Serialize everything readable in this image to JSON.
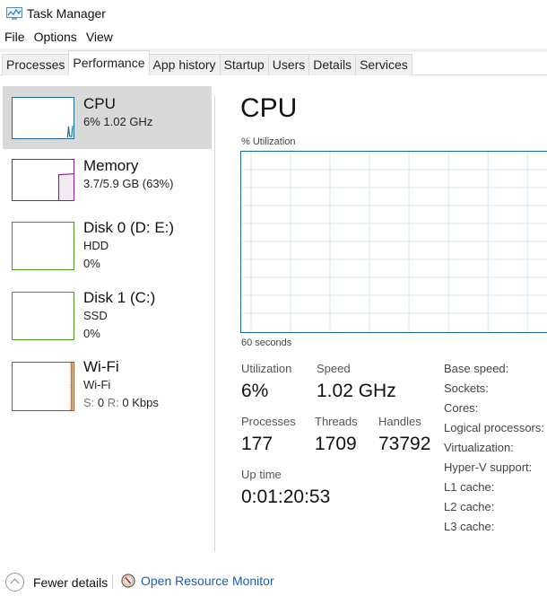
{
  "window": {
    "title": "Task Manager",
    "icon": "task-manager-icon"
  },
  "menu": [
    "File",
    "Options",
    "View"
  ],
  "tabs": [
    {
      "label": "Processes",
      "active": false
    },
    {
      "label": "Performance",
      "active": true
    },
    {
      "label": "App history",
      "active": false
    },
    {
      "label": "Startup",
      "active": false
    },
    {
      "label": "Users",
      "active": false
    },
    {
      "label": "Details",
      "active": false
    },
    {
      "label": "Services",
      "active": false
    }
  ],
  "sidebar": {
    "items": [
      {
        "title": "CPU",
        "line1": "6%  1.02 GHz",
        "line2": "",
        "color": "#1b6a96",
        "selected": true,
        "graph_values_pct": [
          0,
          0,
          0,
          0,
          0,
          0,
          0,
          0,
          0,
          0,
          0,
          0,
          0,
          0,
          0,
          0,
          0,
          0,
          0,
          0,
          0,
          0,
          0,
          0,
          0,
          0,
          0,
          0,
          0,
          0,
          0,
          0,
          0,
          0,
          0,
          0,
          0,
          0,
          0,
          0,
          0,
          0,
          0,
          0,
          0,
          0,
          0,
          0,
          0,
          0,
          0,
          0,
          0,
          0,
          0,
          28,
          4,
          2,
          2,
          30
        ]
      },
      {
        "title": "Memory",
        "line1": "3.7/5.9 GB (63%)",
        "line2": "",
        "color": "#8b1a9b",
        "selected": false,
        "graph_values_pct": [
          63
        ]
      },
      {
        "title": "Disk 0 (D: E:)",
        "line1": "HDD",
        "line2": "0%",
        "color": "#4b9a1f",
        "selected": false
      },
      {
        "title": "Disk 1 (C:)",
        "line1": "SSD",
        "line2": "0%",
        "color": "#4b9a1f",
        "selected": false
      },
      {
        "title": "Wi-Fi",
        "line1": "Wi-Fi",
        "line2_send_label": "S:",
        "line2_send_value": "0",
        "line2_recv_label": "R:",
        "line2_recv_value": "0 Kbps",
        "color": "#a7501b",
        "selected": false
      }
    ]
  },
  "main": {
    "title": "CPU",
    "graph_label": "% Utilization",
    "time_label": "60 seconds",
    "accent_color": "#1b6a96",
    "grid_color": "#d4e6f0",
    "stats": {
      "utilization": {
        "label": "Utilization",
        "value": "6%"
      },
      "speed": {
        "label": "Speed",
        "value": "1.02 GHz"
      },
      "processes": {
        "label": "Processes",
        "value": "177"
      },
      "threads": {
        "label": "Threads",
        "value": "1709"
      },
      "handles": {
        "label": "Handles",
        "value": "73792"
      },
      "uptime": {
        "label": "Up time",
        "value": "0:01:20:53"
      }
    },
    "specs": [
      "Base speed:",
      "Sockets:",
      "Cores:",
      "Logical processors:",
      "Virtualization:",
      "Hyper-V support:",
      "L1 cache:",
      "L2 cache:",
      "L3 cache:"
    ]
  },
  "footer": {
    "fewer_details": "Fewer details",
    "open_resource_monitor": "Open Resource Monitor"
  }
}
